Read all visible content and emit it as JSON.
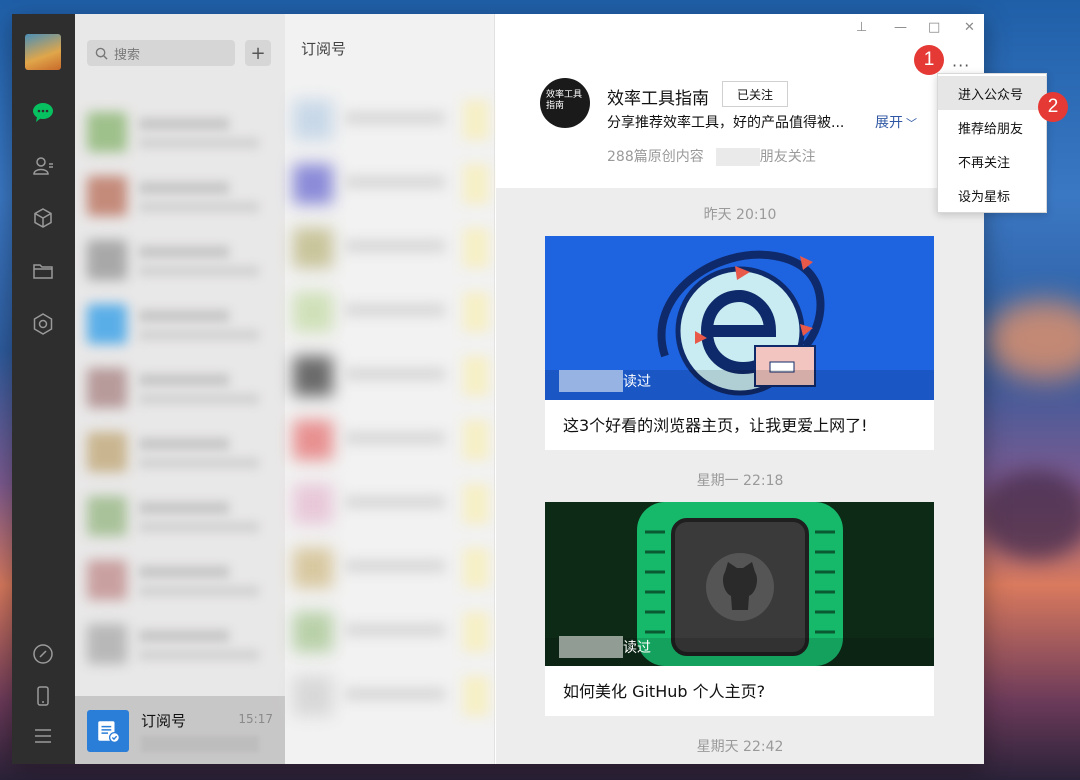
{
  "window_controls": {
    "pin": "⊥",
    "minimize": "—",
    "maximize": "□",
    "close": "✕"
  },
  "search": {
    "placeholder": "搜索"
  },
  "sidebar": {
    "selected_chat": {
      "title": "订阅号",
      "time": "15:17"
    }
  },
  "sublist": {
    "title": "订阅号"
  },
  "profile": {
    "avatar_text": "效率工具指南",
    "name": "效率工具指南",
    "follow_label": "已关注",
    "description": "分享推荐效率工具，好的产品值得被...",
    "expand_label": "展开",
    "original_count": "288篇原创内容",
    "friends_following": "朋友关注",
    "more_label": "···"
  },
  "feed": [
    {
      "date": "昨天 20:10",
      "read_suffix": "读过",
      "title": "这3个好看的浏览器主页，让我更爱上网了!"
    },
    {
      "date": "星期一 22:18",
      "read_suffix": "读过",
      "title": "如何美化 GitHub 个人主页?"
    },
    {
      "date": "星期天 22:42"
    }
  ],
  "menu": {
    "items": [
      "进入公众号",
      "推荐给朋友",
      "不再关注",
      "设为星标"
    ]
  },
  "annotations": {
    "step1": "1",
    "step2": "2"
  },
  "colors": {
    "accent_green": "#07c160",
    "badge_red": "#e53935",
    "link_blue": "#2f57a3"
  }
}
